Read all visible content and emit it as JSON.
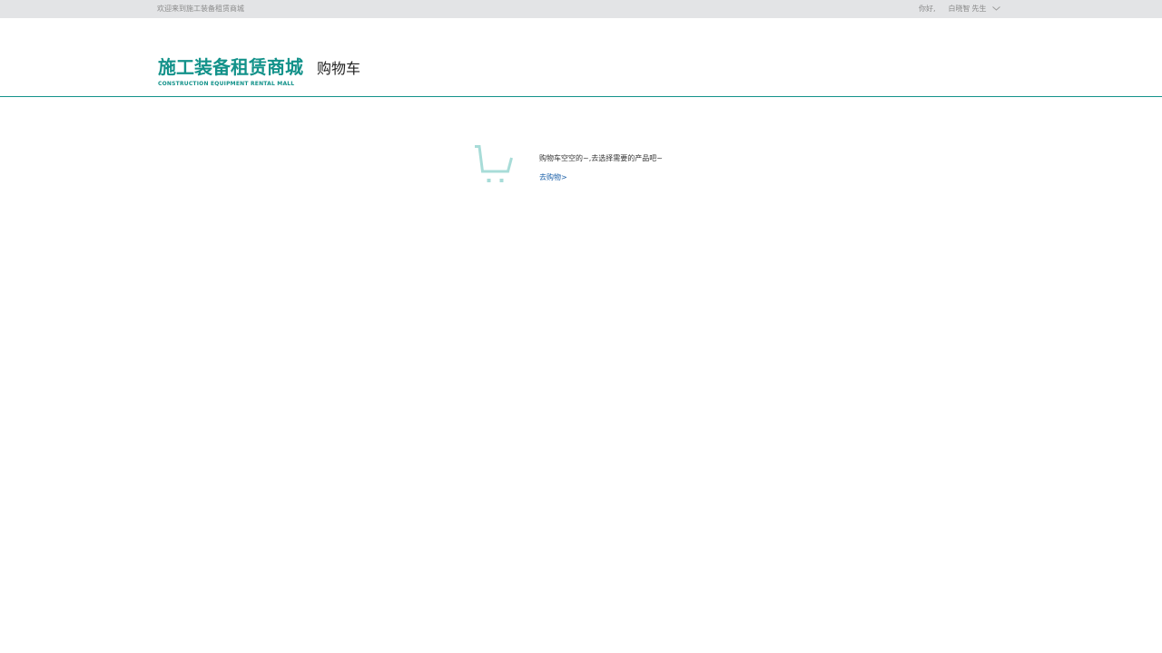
{
  "topbar": {
    "welcome": "欢迎来到施工装备租赁商城",
    "hello": "你好,",
    "user_name": "白晓智",
    "user_title": "先生"
  },
  "header": {
    "logo_cn": "施工装备租赁商城",
    "logo_en": "CONSTRUCTION EQUIPMENT RENTAL MALL",
    "page_title": "购物车"
  },
  "cart": {
    "empty_message": "购物车空空的~,去选择需要的产品吧~",
    "go_shopping_link": "去购物>"
  },
  "colors": {
    "brand": "#13928a",
    "cart_icon": "#a8dcd8",
    "link": "#1a5fa8",
    "topbar_bg": "#e3e4e6"
  },
  "icons": {
    "dropdown": "chevron-down-icon",
    "cart": "shopping-cart-icon"
  }
}
